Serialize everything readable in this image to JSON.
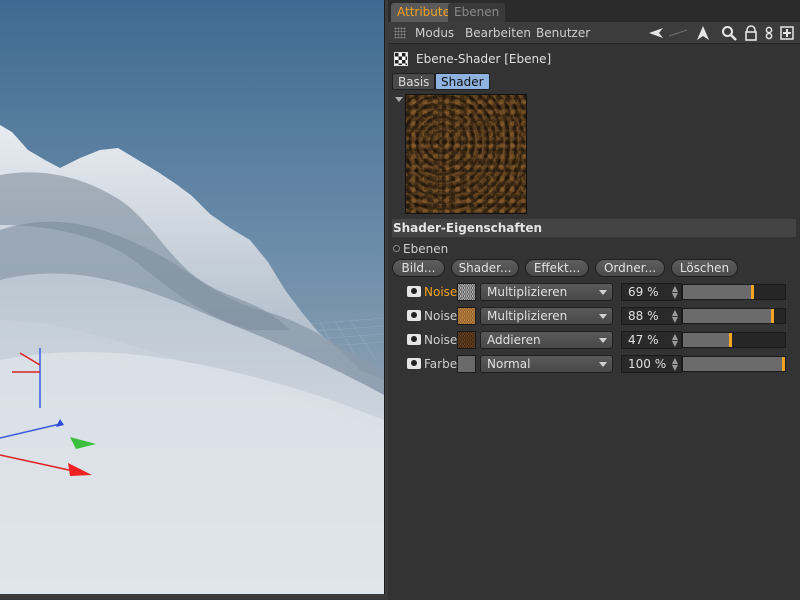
{
  "tabs": {
    "attribute": "Attribute",
    "ebenen": "Ebenen"
  },
  "menu": {
    "modus": "Modus",
    "bearbeiten": "Bearbeiten",
    "benutzer": "Benutzer"
  },
  "object": {
    "title": "Ebene-Shader [Ebene]"
  },
  "subtabs": {
    "basis": "Basis",
    "shader": "Shader"
  },
  "section": {
    "title": "Shader-Eigenschaften",
    "ebenen_label": "Ebenen"
  },
  "buttons": {
    "bild": "Bild...",
    "shader": "Shader...",
    "effekt": "Effekt...",
    "ordner": "Ordner...",
    "loeschen": "Löschen"
  },
  "layers": [
    {
      "name": "Noise",
      "mode": "Multiplizieren",
      "percent_text": "69 %",
      "value": 69,
      "active": true,
      "thumb": "noise-gray"
    },
    {
      "name": "Noise",
      "mode": "Multiplizieren",
      "percent_text": "88 %",
      "value": 88,
      "active": false,
      "thumb": "noise-orange"
    },
    {
      "name": "Noise",
      "mode": "Addieren",
      "percent_text": "47 %",
      "value": 47,
      "active": false,
      "thumb": "noise-brown"
    },
    {
      "name": "Farbe",
      "mode": "Normal",
      "percent_text": "100 %",
      "value": 100,
      "active": false,
      "thumb": "solid-gray"
    }
  ],
  "colors": {
    "accent": "#f3a421",
    "panel_bg": "#333333",
    "tab_active_bg": "#8fb3e0"
  },
  "icons": [
    "back-arrow-icon",
    "cursor-icon",
    "search-icon",
    "lock-icon",
    "link-icon",
    "new-panel-icon",
    "eye-icon",
    "layer-shader-icon"
  ]
}
